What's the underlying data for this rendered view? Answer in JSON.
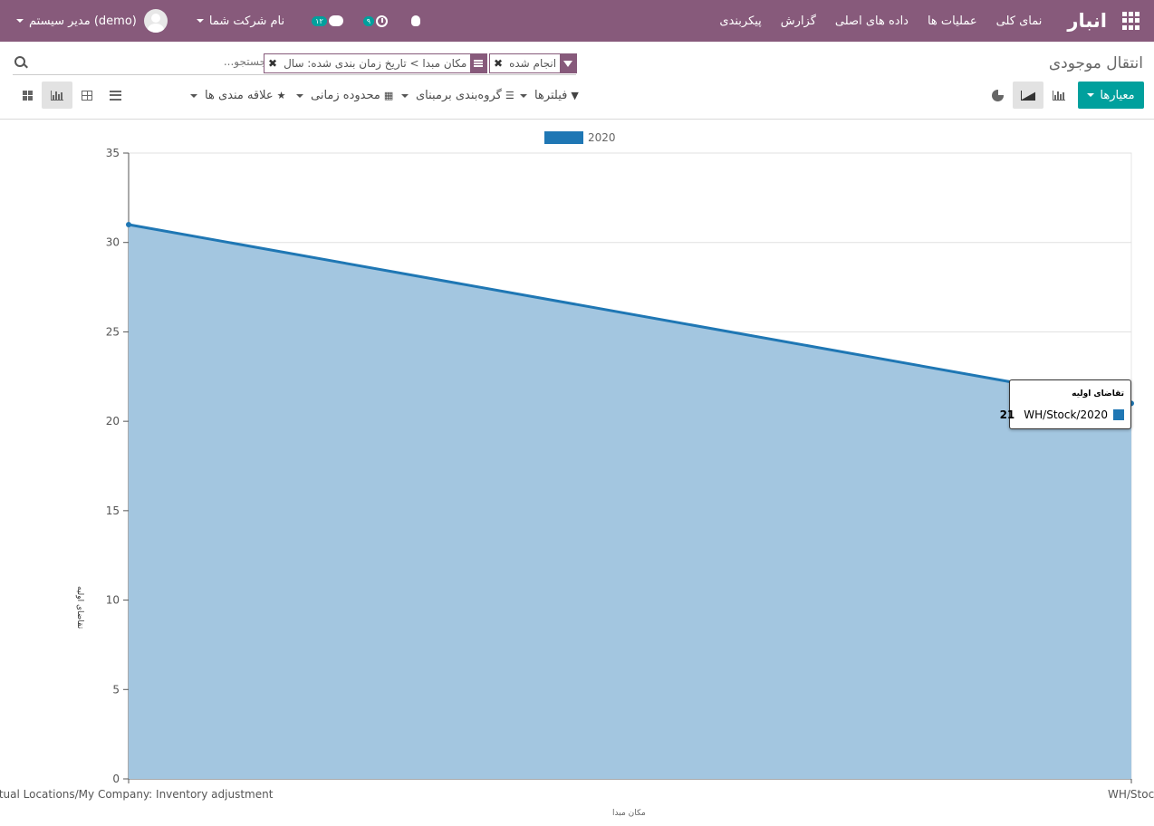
{
  "navbar": {
    "brand": "انبار",
    "menu": [
      "نمای کلی",
      "عملیات ها",
      "داده های اصلی",
      "گزارش",
      "پیکربندی"
    ],
    "user": "مدیر سیستم (demo)",
    "company": "نام شرکت شما",
    "messages_count": "۱۲",
    "activities_count": "۹",
    "icons": [
      "apps-icon",
      "bug-icon",
      "clock-icon",
      "chat-icon",
      "avatar"
    ]
  },
  "control_panel": {
    "title": "انتقال موجودی",
    "search": {
      "placeholder": "جستجو...",
      "facets": [
        {
          "icon": "funnel-icon",
          "label": "انجام شده"
        },
        {
          "icon": "group-by-icon",
          "label": "مکان مبدا > تاریخ زمان بندی شده: سال"
        }
      ]
    },
    "measures_label": "معیارها",
    "dropdowns": {
      "filters": "فیلترها",
      "groupby": "گروه‌بندی برمبنای",
      "timerange": "محدوده زمانی",
      "favorites": "علاقه مندی ها"
    }
  },
  "colors": {
    "navbar": "#875a7b",
    "accent": "#00a09d",
    "series_line": "#1f77b4",
    "series_fill": "#a3c6e0"
  },
  "chart_data": {
    "type": "area",
    "categories": [
      "Virtual Locations/My Company: Inventory adjustment",
      "WH/Stock"
    ],
    "series": [
      {
        "name": "2020",
        "values": [
          31,
          21
        ]
      }
    ],
    "xlabel": "مکان مبدا",
    "ylabel": "تقاضای اولیه",
    "ylim": [
      0,
      35
    ],
    "yticks": [
      0,
      5,
      10,
      15,
      20,
      25,
      30,
      35
    ],
    "grid": true,
    "legend": "top-center",
    "tooltip": {
      "title": "تقاضای اولیه",
      "label": "WH/Stock/2020",
      "value": "21"
    }
  }
}
